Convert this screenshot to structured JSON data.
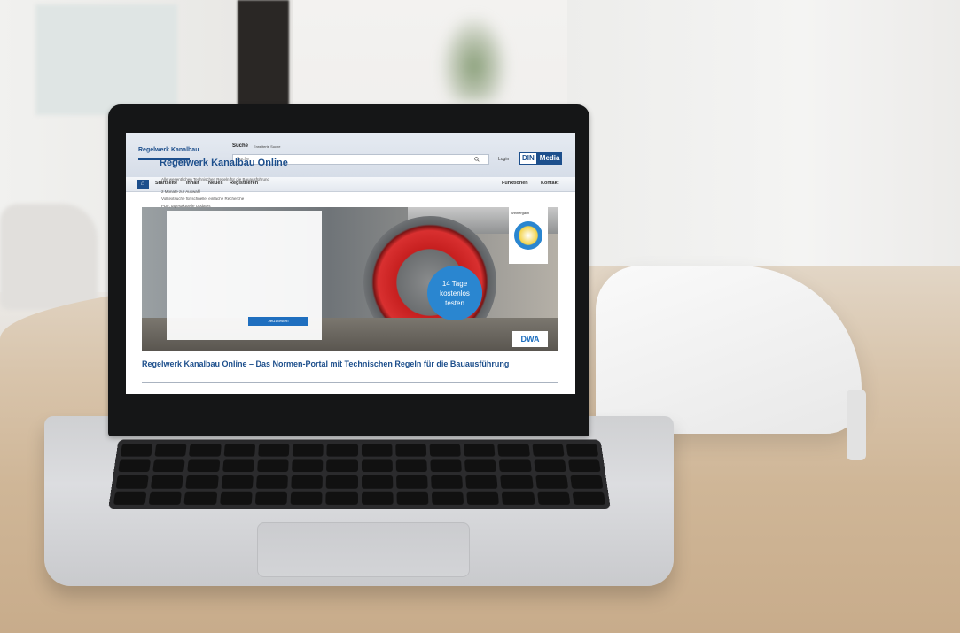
{
  "site": {
    "logo_name": "Regelwerk Kanalbau",
    "logo_sub": "ONLINE",
    "search_label": "Suche",
    "search_hint": "Erweiterte Suche",
    "search_placeholder": "Suche",
    "login": "Login",
    "brand_din": "DIN",
    "brand_media": "Media"
  },
  "nav": {
    "home_icon": "home-icon",
    "items": [
      "Startseite",
      "Inhalt",
      "Neues",
      "Registrieren"
    ],
    "right_items": [
      "Funktionen",
      "Kontakt"
    ]
  },
  "hero": {
    "title": "Regelwerk Kanalbau Online",
    "bullets": [
      "Alle wesentlichen Technischen Regeln für die Bauausführung",
      "2 Monate zur Auswahl",
      "Volltextsuche für schnelle, einfache Recherche",
      "PDF, tagesaktuelle Updates"
    ],
    "button": "Jetzt testen",
    "badge_lines": [
      "14 Tage",
      "kostenlos",
      "testen"
    ],
    "award_label": "Winnergalin",
    "dwa": "DWA"
  },
  "page": {
    "title": "Regelwerk Kanalbau Online – Das Normen-Portal mit Technischen Regeln für die Bauausführung"
  }
}
